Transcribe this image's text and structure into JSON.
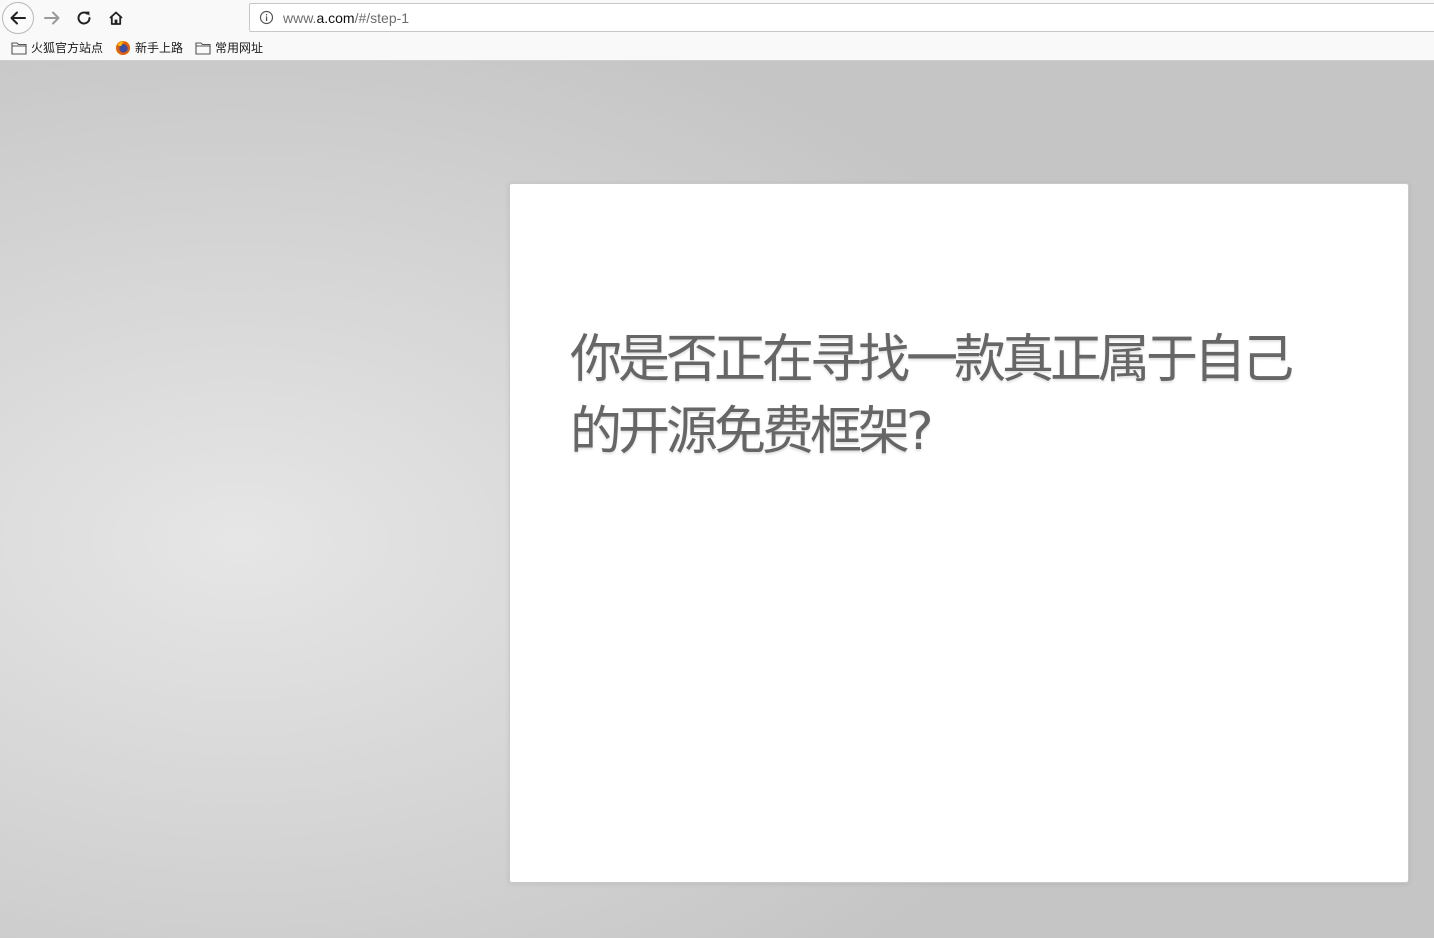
{
  "toolbar": {
    "back_icon": "arrow-left-icon",
    "forward_icon": "arrow-right-icon",
    "reload_icon": "reload-icon",
    "home_icon": "home-icon"
  },
  "urlbar": {
    "site_info_icon": "info-icon",
    "url_prefix": "www.",
    "url_host": "a.com",
    "url_path": "/#/step-1"
  },
  "bookmarks": [
    {
      "label": "火狐官方站点",
      "icon": "folder-icon"
    },
    {
      "label": "新手上路",
      "icon": "firefox-icon"
    },
    {
      "label": "常用网址",
      "icon": "folder-icon"
    }
  ],
  "slide": {
    "heading": "你是否正在寻找一款真正属于自己的开源免费框架?"
  },
  "colors": {
    "slide_text": "#666666",
    "background": "#d4d4d4",
    "card": "#ffffff"
  }
}
